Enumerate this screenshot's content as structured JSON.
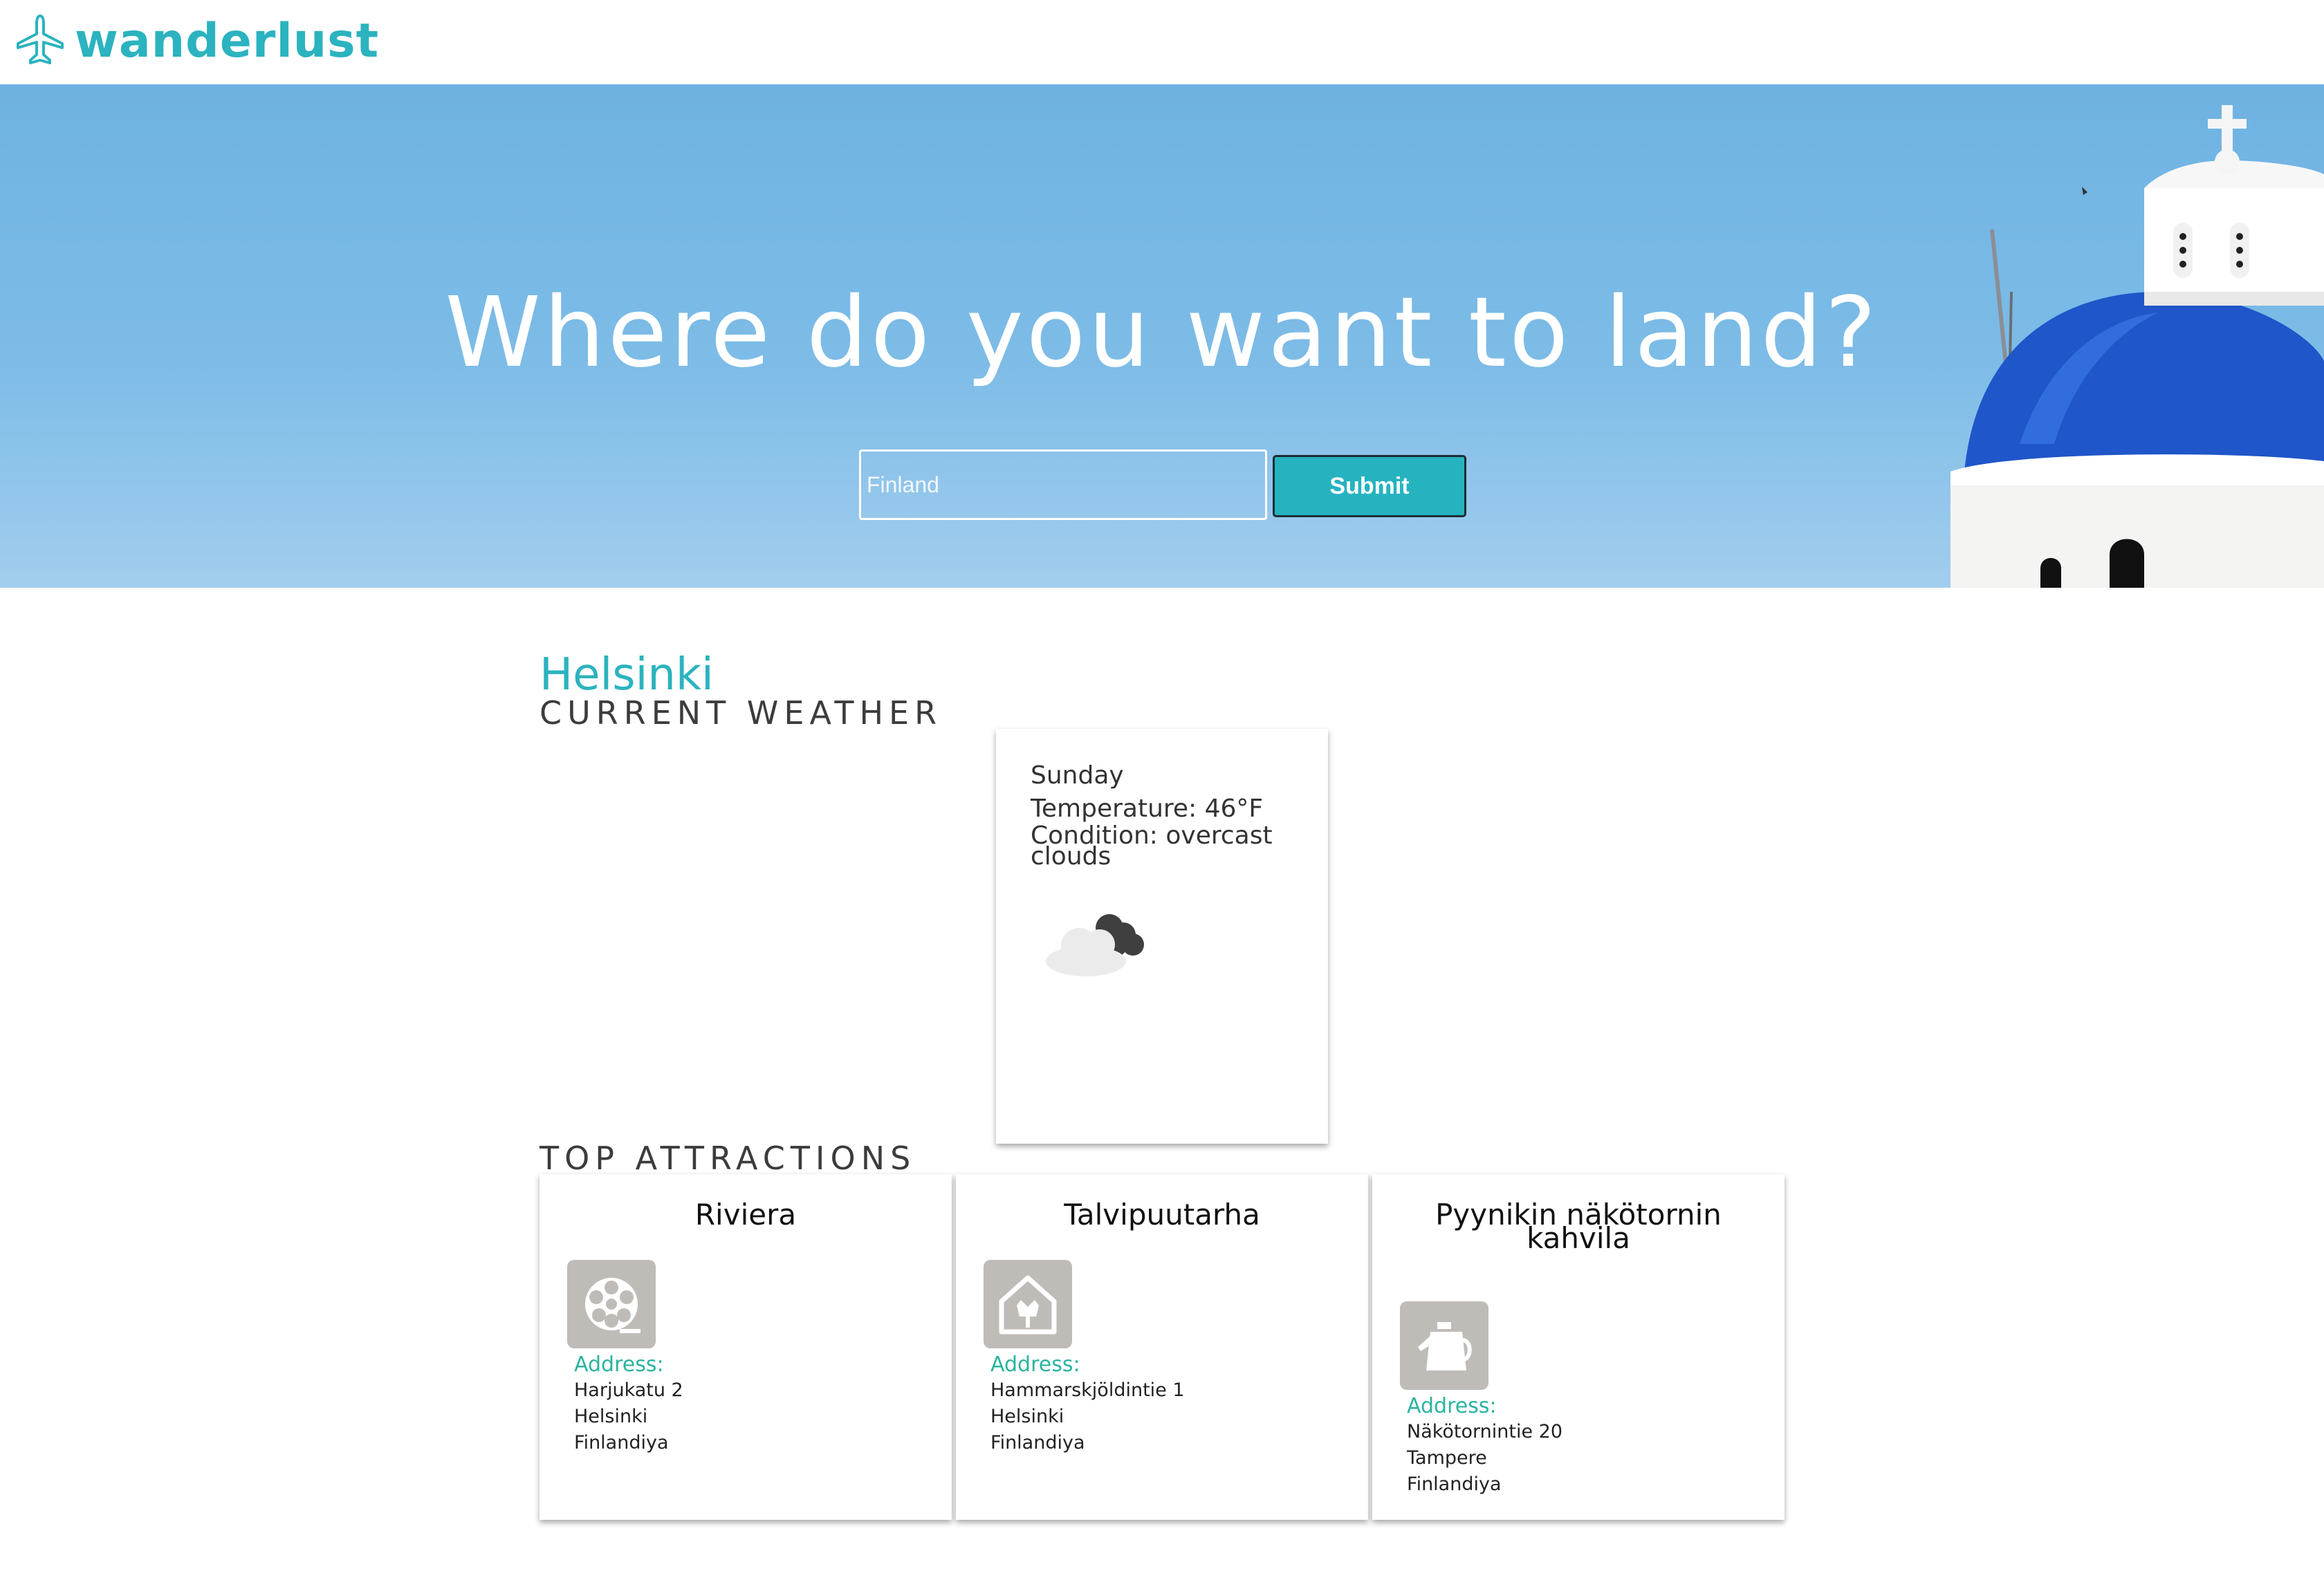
{
  "header": {
    "logo_text": "wanderlust",
    "logo_icon": "airplane-icon",
    "accent_color": "#2bb3bf"
  },
  "hero": {
    "title": "Where do you want to land?",
    "search_placeholder": "Finland",
    "submit_label": "Submit",
    "submit_color": "#26b3c0"
  },
  "weather": {
    "city": "Helsinki",
    "heading": "CURRENT WEATHER",
    "day": "Sunday",
    "temperature": "Temperature: 46°F",
    "condition": "Condition: overcast clouds",
    "icon": "overcast-clouds-icon"
  },
  "attractions": {
    "heading": "TOP ATTRACTIONS",
    "address_label": "Address:",
    "items": [
      {
        "name": "Riviera",
        "icon": "film-reel-icon",
        "address": [
          "Harjukatu 2",
          "Helsinki",
          "Finlandiya"
        ]
      },
      {
        "name": "Talvipuutarha",
        "icon": "greenhouse-flower-icon",
        "address": [
          "Hammarskjöldintie 1",
          "Helsinki",
          "Finlandiya"
        ]
      },
      {
        "name": "Pyynikin näkötornin kahvila",
        "icon": "coffee-pot-icon",
        "address": [
          "Näkötornintie 20",
          "Tampere",
          "Finlandiya"
        ]
      }
    ]
  }
}
